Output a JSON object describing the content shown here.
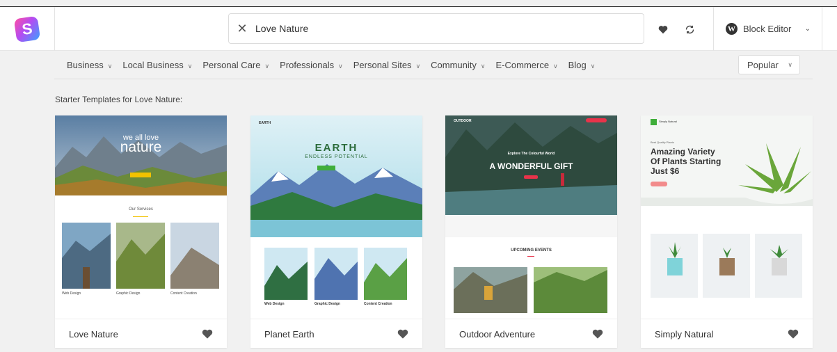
{
  "search": {
    "value": "Love Nature",
    "clear_icon": "close-icon"
  },
  "toolbar": {
    "favorites_icon": "heart-icon",
    "sync_icon": "refresh-icon"
  },
  "editor": {
    "label": "Block Editor"
  },
  "categories": [
    {
      "label": "Business"
    },
    {
      "label": "Local Business"
    },
    {
      "label": "Personal Care"
    },
    {
      "label": "Professionals"
    },
    {
      "label": "Personal Sites"
    },
    {
      "label": "Community"
    },
    {
      "label": "E-Commerce"
    },
    {
      "label": "Blog"
    }
  ],
  "sort": {
    "selected": "Popular"
  },
  "section_title": "Starter Templates for Love Nature:",
  "templates": [
    {
      "name": "Love Nature",
      "thumb": {
        "hero_small": "we all love",
        "hero_big": "nature",
        "services_heading": "Our Services",
        "cols": [
          "Web Design",
          "Graphic Design",
          "Content Creation"
        ]
      }
    },
    {
      "name": "Planet Earth",
      "thumb": {
        "brand": "EARTH",
        "hero_title": "EARTH",
        "hero_sub": "ENDLESS POTENTIAL",
        "cols": [
          "Web Design",
          "Graphic Design",
          "Content Creation"
        ]
      }
    },
    {
      "name": "Outdoor Adventure",
      "thumb": {
        "brand": "OUTDOOR",
        "hero_small": "Explore The Colourful World",
        "hero_big": "A WONDERFUL GIFT",
        "events_heading": "UPCOMING EVENTS"
      }
    },
    {
      "name": "Simply Natural",
      "thumb": {
        "brand": "Simply Natural",
        "hero_small": "Best Quality Plants",
        "hero_big_1": "Amazing Variety",
        "hero_big_2": "Of Plants Starting",
        "hero_big_3": "Just $6"
      }
    }
  ],
  "colors": {
    "accent_green": "#3fae3a",
    "outdoor_red": "#e8334a",
    "logo_pink": "#ff4fa3",
    "logo_blue": "#3aa0ff"
  }
}
